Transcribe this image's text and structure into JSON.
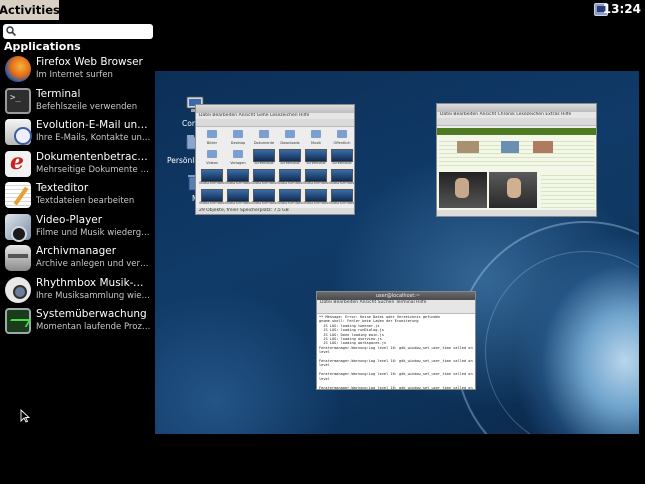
{
  "top_panel": {
    "activities_label": "Activities",
    "clock": "13:24",
    "tray_icon": "network-icon"
  },
  "search": {
    "placeholder": "",
    "value": "",
    "icon": "search-icon"
  },
  "applications": {
    "heading": "Applications",
    "items": [
      {
        "name": "Firefox Web Browser",
        "description": "Im Internet surfen",
        "icon": "firefox-icon"
      },
      {
        "name": "Terminal",
        "description": "Befehlszeile verwenden",
        "icon": "terminal-icon"
      },
      {
        "name": "Evolution-E-Mail und -K...",
        "description": "Ihre E-Mails, Kontakte und K...",
        "icon": "evolution-icon"
      },
      {
        "name": "Dokumentenbetrachter",
        "description": "Mehrseitige Dokumente anz...",
        "icon": "document-viewer-icon"
      },
      {
        "name": "Texteditor",
        "description": "Textdateien bearbeiten",
        "icon": "text-editor-icon"
      },
      {
        "name": "Video-Player",
        "description": "Filme und Musik wiedergeben",
        "icon": "video-player-icon"
      },
      {
        "name": "Archivmanager",
        "description": "Archive anlegen und veränd...",
        "icon": "archive-manager-icon"
      },
      {
        "name": "Rhythmbox Musik-Wied...",
        "description": "Ihre Musiksammlung wieder...",
        "icon": "rhythmbox-icon"
      },
      {
        "name": "Systemüberwachung",
        "description": "Momentan laufende Prozess...",
        "icon": "system-monitor-icon"
      }
    ]
  },
  "workspace": {
    "desktop_icons": [
      {
        "label": "Com",
        "icon": "computer-icon"
      },
      {
        "label": "Persönlic",
        "icon": "home-folder-icon"
      },
      {
        "label": "M",
        "icon": "trash-icon"
      }
    ],
    "windows": {
      "file_manager": {
        "menu": "Datei  Bearbeiten  Ansicht  Gehe  Lesezeichen  Hilfe",
        "status": "29 Objekte, freier Speicherplatz: 7,5 GB",
        "items": [
          "Bilder",
          "Desktop",
          "Dokumente",
          "Downloads",
          "Musik",
          "Öffentlich",
          "Videos",
          "Vorlagen",
          "Screenshot",
          "Screenshot",
          "Screenshot",
          "Screenshot",
          "Bildschirmfoto",
          "Bildschirmfoto",
          "Bildschirmfoto",
          "Bildschirmfoto",
          "Bildschirmfoto",
          "Bildschirmfoto",
          "Bildschirmfoto",
          "Bildschirmfoto",
          "Bildschirmfoto",
          "Bildschirmfoto",
          "Bildschirmfoto",
          "Bildschirmfoto"
        ]
      },
      "browser": {
        "menu": "Datei  Bearbeiten  Ansicht  Chronik  Lesezeichen  Extras  Hilfe"
      },
      "terminal": {
        "title": "user@localhost:~",
        "menu": "Datei  Bearbeiten  Ansicht  Suchen  Terminal  Hilfe",
        "lines": [
          "** Message: Error: Keine Datei oder Verzeichnis gefunden",
          "gnome-shell: Fehler beim Laden der Erweiterung",
          "  JS LOG: loading tweener.js",
          "  JS LOG: loading runDialog.js",
          "  JS LOG: Done loading main.js",
          "  JS LOG: loading overview.js",
          "  JS LOG: loading workspaces.js",
          "Fenstermanager-Warnung:Log level 16: gdk_window_set_user_time called on non-top",
          "level",
          "",
          "Fenstermanager-Warnung:Log level 16: gdk_window_set_user_time called on non-top",
          "level",
          "",
          "Fenstermanager-Warnung:Log level 16: gdk_window_set_user_time called on non-top",
          "level",
          "",
          "Fenstermanager-Warnung:Log level 16: gdk_window_set_user_time called on non-top",
          "level",
          "$ "
        ]
      }
    }
  }
}
